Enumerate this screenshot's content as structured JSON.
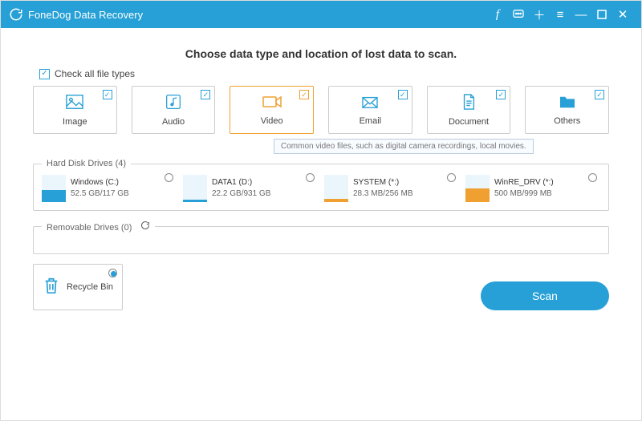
{
  "app": {
    "title": "FoneDog Data Recovery"
  },
  "heading": "Choose data type and location of lost data to scan.",
  "checkAllLabel": "Check all file types",
  "cards": {
    "image": "Image",
    "audio": "Audio",
    "video": "Video",
    "email": "Email",
    "document": "Document",
    "others": "Others"
  },
  "tooltip": "Common video files, such as digital camera recordings, local movies.",
  "sections": {
    "hdd": "Hard Disk Drives (4)",
    "removable": "Removable Drives (0)"
  },
  "drives": [
    {
      "name": "Windows (C:)",
      "size": "52.5 GB/117 GB",
      "fill": 45,
      "color": "#26a0d6",
      "win": true
    },
    {
      "name": "DATA1 (D:)",
      "size": "22.2 GB/931 GB",
      "fill": 10,
      "color": "#26a0d6"
    },
    {
      "name": "SYSTEM (*:)",
      "size": "28.3 MB/256 MB",
      "fill": 12,
      "color": "#f0a030"
    },
    {
      "name": "WinRE_DRV (*:)",
      "size": "500 MB/999 MB",
      "fill": 50,
      "color": "#f0a030"
    }
  ],
  "recycle": {
    "label": "Recycle Bin"
  },
  "scanLabel": "Scan"
}
